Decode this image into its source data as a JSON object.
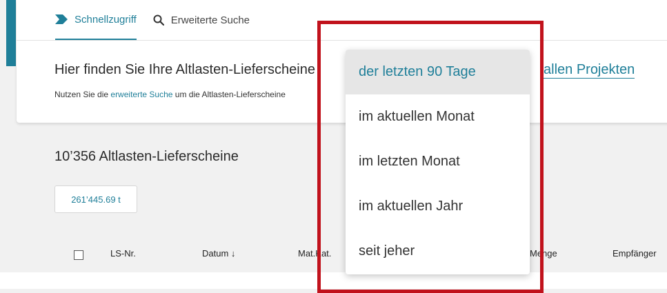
{
  "tabs": [
    {
      "label": "Schnellzugriff",
      "active": true,
      "icon": "chevron-tag-icon"
    },
    {
      "label": "Erweiterte Suche",
      "active": false,
      "icon": "search-icon"
    }
  ],
  "header": {
    "headline": "Hier finden Sie Ihre Altlasten-Lieferscheine",
    "link": "allen Projekten",
    "hint_prefix": "Nutzen Sie die",
    "hint_link": "erweiterte Suche",
    "hint_suffix": "um die Altlasten-Lieferscheine"
  },
  "summary": {
    "count": "10’356 Altlasten-Lieferscheine",
    "tonnage": "261’445.69 t"
  },
  "table": {
    "columns": {
      "ls_nr": "LS-Nr.",
      "datum": "Datum ↓",
      "mat_kat": "Mat.Kat.",
      "menge": "Menge",
      "empfaenger": "Empfänger"
    }
  },
  "dropdown": {
    "options": [
      "der letzten 90 Tage",
      "im aktuellen Monat",
      "im letzten Monat",
      "im aktuellen Jahr",
      "seit jeher"
    ],
    "selected": "der letzten 90 Tage"
  },
  "colors": {
    "accent": "#1f7f99",
    "highlight": "#c1121c"
  }
}
